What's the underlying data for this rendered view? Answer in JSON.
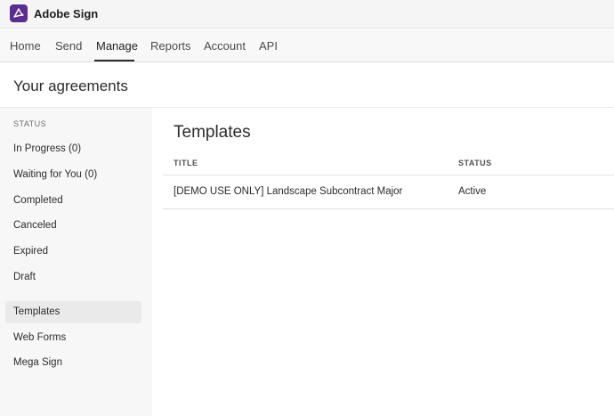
{
  "app": {
    "title": "Adobe Sign"
  },
  "nav": {
    "tabs": [
      "Home",
      "Send",
      "Manage",
      "Reports",
      "Account",
      "API"
    ],
    "active": "Manage"
  },
  "page": {
    "title": "Your agreements"
  },
  "sidebar": {
    "heading": "STATUS",
    "items": [
      "In Progress (0)",
      "Waiting for You (0)",
      "Completed",
      "Canceled",
      "Expired",
      "Draft",
      "Templates",
      "Web Forms",
      "Mega Sign"
    ],
    "selected": "Templates"
  },
  "main": {
    "title": "Templates",
    "columns": [
      "TITLE",
      "STATUS"
    ],
    "rows": [
      {
        "title": "[DEMO USE ONLY] Landscape Subcontract Major",
        "status": "Active"
      }
    ]
  },
  "colors": {
    "brand": "#5c2d91",
    "selected_bg": "#eaeaea",
    "sidebar_bg": "#f7f7f7"
  }
}
